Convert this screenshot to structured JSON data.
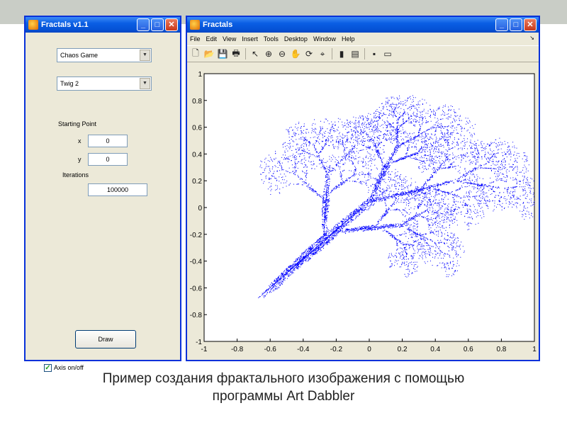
{
  "left_window": {
    "title": "Fractals v1.1",
    "method_select": "Chaos Game",
    "fractal_select": "Twig 2",
    "starting_point_label": "Starting Point",
    "x_label": "x",
    "x_value": "0",
    "y_label": "y",
    "y_value": "0",
    "iterations_label": "Iterations",
    "iterations_value": "100000",
    "draw_button": "Draw",
    "axis_checkbox_label": "Axis on/off",
    "axis_checked": true
  },
  "figure_window": {
    "title": "Fractals",
    "menu": [
      "File",
      "Edit",
      "View",
      "Insert",
      "Tools",
      "Desktop",
      "Window",
      "Help"
    ],
    "menu_arrow": "↘",
    "toolbar_icons": [
      "new-file-icon",
      "open-folder-icon",
      "save-icon",
      "print-icon",
      "pointer-icon",
      "zoom-in-icon",
      "zoom-out-icon",
      "pan-icon",
      "rotate-icon",
      "data-cursor-icon",
      "colorbar-icon",
      "legend-icon",
      "hide-tools-icon",
      "show-tools-icon"
    ]
  },
  "chart_data": {
    "type": "scatter",
    "title": "",
    "xlabel": "",
    "ylabel": "",
    "xlim": [
      -1,
      1
    ],
    "ylim": [
      -1,
      1
    ],
    "x_ticks": [
      "-1",
      "-0.8",
      "-0.6",
      "-0.4",
      "-0.2",
      "0",
      "0.2",
      "0.4",
      "0.6",
      "0.8",
      "1"
    ],
    "y_ticks": [
      "1",
      "0.8",
      "0.6",
      "0.4",
      "0.2",
      "0",
      "-0.2",
      "-0.4",
      "-0.6",
      "-0.8",
      "-1"
    ],
    "grid": false,
    "marker_color": "#0000ff",
    "description_points": "fern-like fractal point cloud generated by chaos game (Twig 2), 100000 iterations",
    "iterations": 100000
  },
  "caption": {
    "line1": "Пример создания фрактального изображения с помощью",
    "line2": "программы Art Dabbler"
  }
}
